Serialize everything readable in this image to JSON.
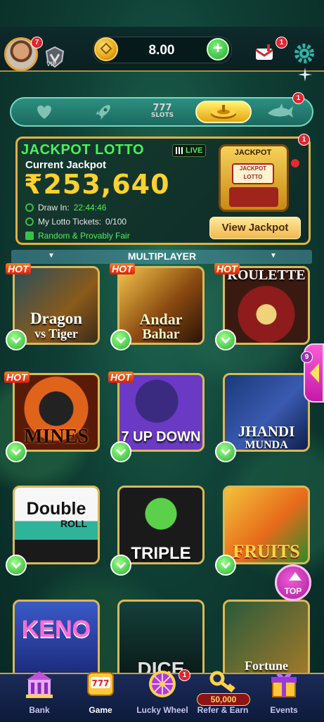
{
  "header": {
    "avatar_badge": "7",
    "vip_label": "VIP",
    "balance": "8.00",
    "mail_badge": "1"
  },
  "tabs": [
    {
      "id": "favorites",
      "icon": "heart-icon"
    },
    {
      "id": "rocket",
      "icon": "rocket-icon"
    },
    {
      "id": "slots",
      "label_top": "777",
      "label": "SLOTS",
      "icon": "slots-icon"
    },
    {
      "id": "multiplayer",
      "icon": "roulette-icon",
      "active": true
    },
    {
      "id": "fish",
      "icon": "shark-icon",
      "badge": "1"
    }
  ],
  "jackpot": {
    "badge": "1",
    "title": "JACKPOT LOTTO",
    "live": "LIVE",
    "current_label": "Current Jackpot",
    "amount": "₹253,640",
    "draw_label": "Draw In:",
    "draw_time": "22:44:46",
    "tickets_label": "My Lotto Tickets:",
    "tickets_value": "0/100",
    "fair_text": "Random & Provably Fair",
    "machine_label": "JACKPOT",
    "machine_screen": "JACKPOT LOTTO",
    "view_button": "View Jackpot"
  },
  "section": {
    "title": "MULTIPLAYER"
  },
  "games": [
    {
      "name": "Dragon vs Tiger",
      "line1": "Dragon",
      "line2": "vs Tiger",
      "hot": "HOT"
    },
    {
      "name": "Andar Bahar",
      "line1": "Andar",
      "line2": "Bahar",
      "hot": "HOT"
    },
    {
      "name": "Roulette",
      "line1": "ROULETTE",
      "hot": "HOT"
    },
    {
      "name": "Mines",
      "line1": "MINES",
      "hot": "HOT"
    },
    {
      "name": "7 Up Down",
      "line1": "7 UP DOWN",
      "hot": "HOT"
    },
    {
      "name": "Jhandi Munda",
      "line1": "JHANDI",
      "line2": "MUNDA"
    },
    {
      "name": "Double Roll",
      "line1": "Double",
      "line2": "ROLL"
    },
    {
      "name": "Triple",
      "line1": "TRIPLE"
    },
    {
      "name": "Fruits",
      "line1": "FRUITS"
    },
    {
      "name": "Keno",
      "line1": "KENO"
    },
    {
      "name": "Dice",
      "line1": "DICE"
    },
    {
      "name": "Fortune",
      "line1": "Fortune"
    }
  ],
  "side_tab": {
    "badge": "9"
  },
  "top_button": "TOP",
  "bottom_nav": [
    {
      "label": "Bank",
      "icon": "bank-icon"
    },
    {
      "label": "Game",
      "icon": "slot-machine-icon",
      "active": true
    },
    {
      "label": "Lucky Wheel",
      "icon": "wheel-icon",
      "badge": "1"
    },
    {
      "label": "Refer & Earn",
      "icon": "key-icon",
      "amount": "50,000"
    },
    {
      "label": "Events",
      "icon": "gift-icon"
    }
  ],
  "colors": {
    "accent_gold": "#e1b23e",
    "jackpot_green": "#4cf05a",
    "jackpot_amount": "#ffd22e"
  }
}
